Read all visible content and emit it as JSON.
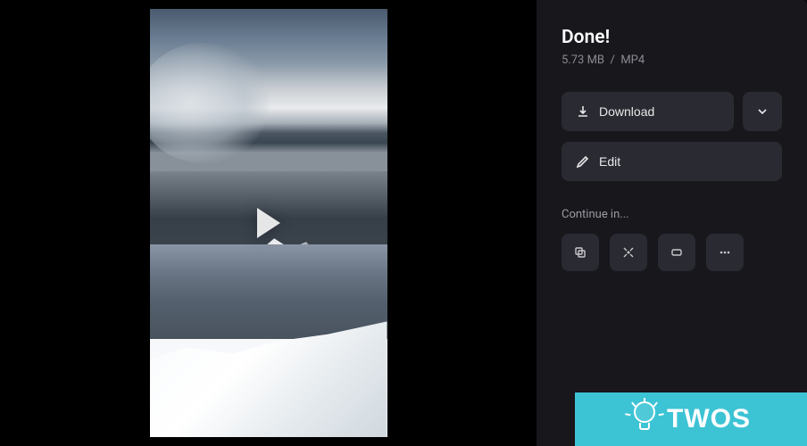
{
  "status": {
    "title": "Done!",
    "file_size": "5.73 MB",
    "separator": "/",
    "format": "MP4"
  },
  "actions": {
    "download_label": "Download",
    "edit_label": "Edit"
  },
  "continue": {
    "label": "Continue in...",
    "icons": [
      "copy-icon",
      "compress-icon",
      "crop-icon",
      "more-icon"
    ]
  },
  "watermark": {
    "text": "TWOS"
  },
  "colors": {
    "bg": "#17171c",
    "btn": "#2a2a32",
    "accent": "#3cc3d4"
  }
}
